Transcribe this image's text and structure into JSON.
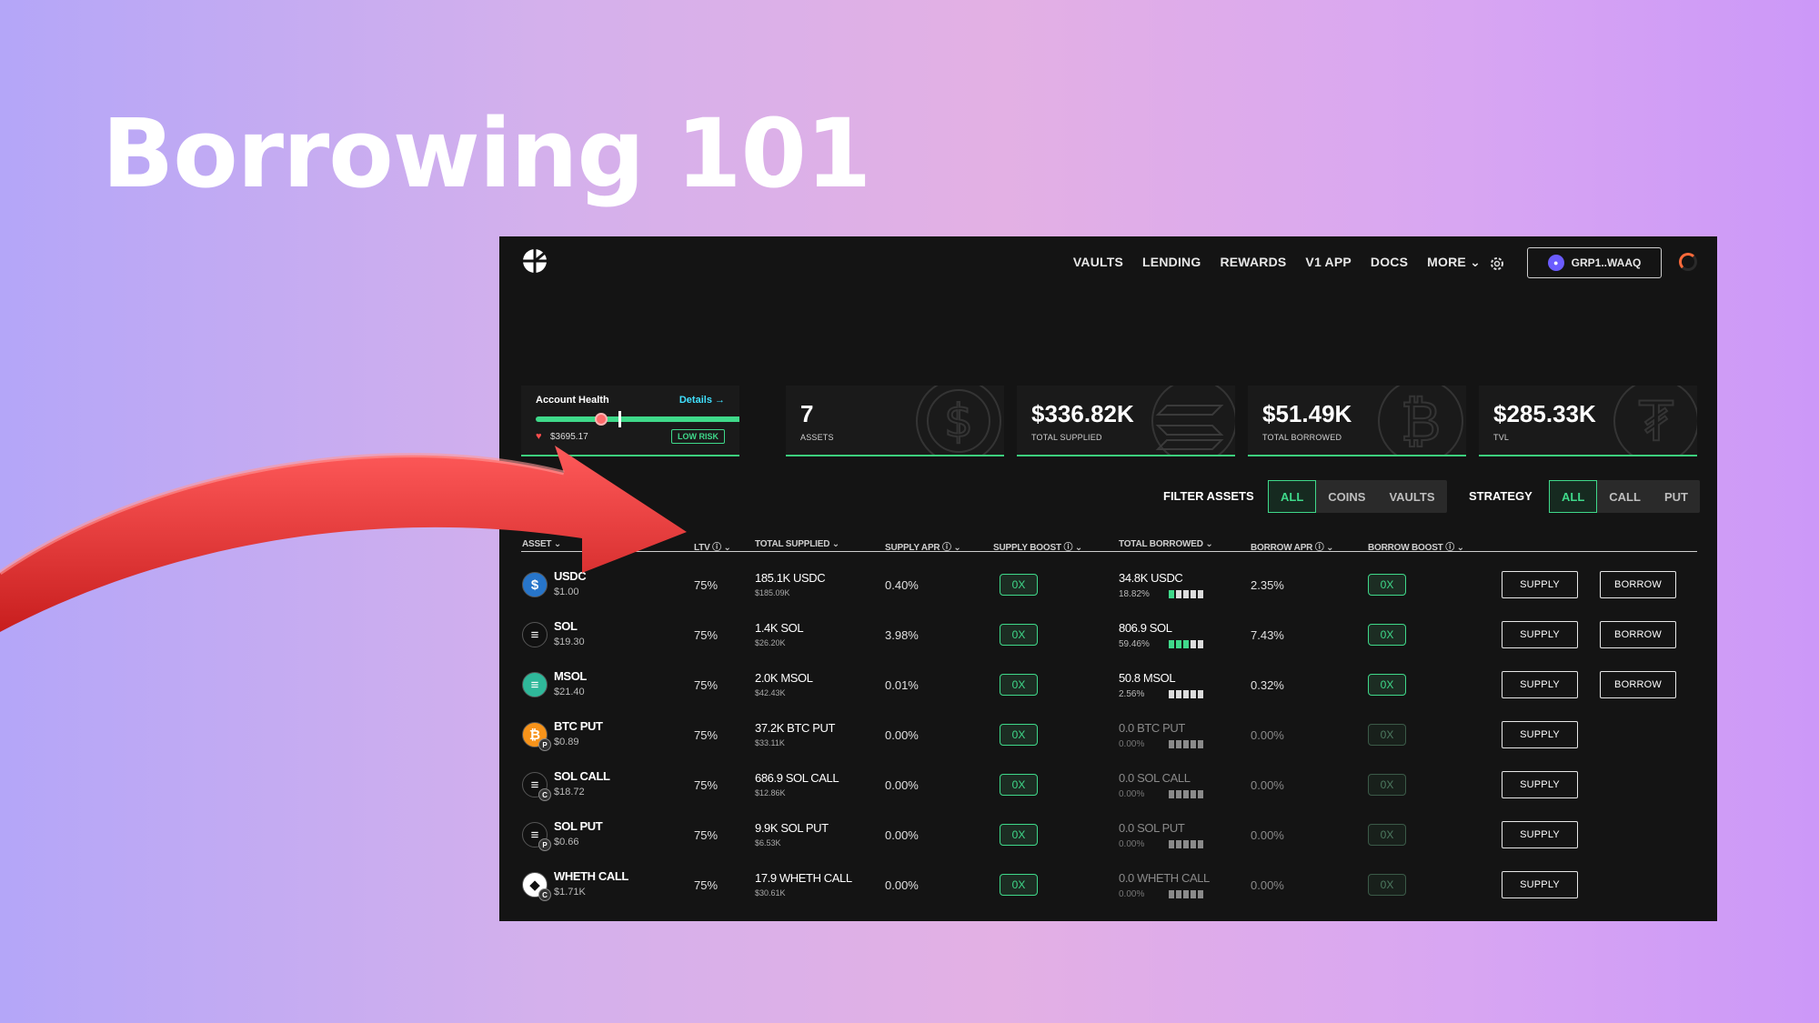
{
  "headline": "Borrowing 101",
  "nav": {
    "items": [
      "VAULTS",
      "LENDING",
      "REWARDS",
      "V1 APP",
      "DOCS",
      "MORE"
    ],
    "wallet_label": "GRP1..WAAQ"
  },
  "stats": {
    "health": {
      "title": "Account Health",
      "details": "Details →",
      "amount": "$3695.17",
      "risk": "LOW RISK",
      "level": 0.3
    },
    "assets": {
      "value": "7",
      "label": "ASSETS"
    },
    "supplied": {
      "value": "$336.82K",
      "label": "TOTAL SUPPLIED"
    },
    "borrowed": {
      "value": "$51.49K",
      "label": "TOTAL BORROWED"
    },
    "tvl": {
      "value": "$285.33K",
      "label": "TVL"
    }
  },
  "filters": {
    "label": "FILTER ASSETS",
    "options": [
      "ALL",
      "COINS",
      "VAULTS"
    ],
    "strategy_label": "STRATEGY",
    "strategy_options": [
      "ALL",
      "CALL",
      "PUT"
    ]
  },
  "table": {
    "headers": [
      "ASSET",
      "LTV",
      "TOTAL SUPPLIED",
      "SUPPLY APR",
      "SUPPLY BOOST",
      "TOTAL BORROWED",
      "BORROW APR",
      "BORROW BOOST"
    ],
    "supply_label": "SUPPLY",
    "borrow_label": "BORROW",
    "rows": [
      {
        "name": "USDC",
        "price": "$1.00",
        "ltv": "75%",
        "supplied": "185.1K USDC",
        "supplied_usd": "$185.09K",
        "supply_apr": "0.40%",
        "supply_boost": "0X",
        "borrowed_amt": "34.8K",
        "borrowed_sym": "USDC",
        "util": "18.82%",
        "util_bars": 1,
        "borrow_apr": "2.35%",
        "borrow_boost": "0X",
        "borrowable": true,
        "icon_color": "#2775ca",
        "icon": "$",
        "sub": ""
      },
      {
        "name": "SOL",
        "price": "$19.30",
        "ltv": "75%",
        "supplied": "1.4K SOL",
        "supplied_usd": "$26.20K",
        "supply_apr": "3.98%",
        "supply_boost": "0X",
        "borrowed_amt": "806.9",
        "borrowed_sym": "SOL",
        "util": "59.46%",
        "util_bars": 3,
        "borrow_apr": "7.43%",
        "borrow_boost": "0X",
        "borrowable": true,
        "icon_color": "#111111",
        "icon": "≡",
        "sub": ""
      },
      {
        "name": "MSOL",
        "price": "$21.40",
        "ltv": "75%",
        "supplied": "2.0K MSOL",
        "supplied_usd": "$42.43K",
        "supply_apr": "0.01%",
        "supply_boost": "0X",
        "borrowed_amt": "50.8",
        "borrowed_sym": "MSOL",
        "util": "2.56%",
        "util_bars": 0,
        "borrow_apr": "0.32%",
        "borrow_boost": "0X",
        "borrowable": true,
        "icon_color": "#2fb89a",
        "icon": "≡",
        "sub": ""
      },
      {
        "name": "BTC PUT",
        "price": "$0.89",
        "ltv": "75%",
        "supplied": "37.2K BTC PUT",
        "supplied_usd": "$33.11K",
        "supply_apr": "0.00%",
        "supply_boost": "0X",
        "borrowed_amt": "0.0",
        "borrowed_sym": "BTC PUT",
        "util": "0.00%",
        "util_bars": 0,
        "borrow_apr": "0.00%",
        "borrow_boost": "0X",
        "borrowable": false,
        "icon_color": "#f7931a",
        "icon": "₿",
        "sub": "P"
      },
      {
        "name": "SOL CALL",
        "price": "$18.72",
        "ltv": "75%",
        "supplied": "686.9 SOL CALL",
        "supplied_usd": "$12.86K",
        "supply_apr": "0.00%",
        "supply_boost": "0X",
        "borrowed_amt": "0.0",
        "borrowed_sym": "SOL CALL",
        "util": "0.00%",
        "util_bars": 0,
        "borrow_apr": "0.00%",
        "borrow_boost": "0X",
        "borrowable": false,
        "icon_color": "#111111",
        "icon": "≡",
        "sub": "C"
      },
      {
        "name": "SOL PUT",
        "price": "$0.66",
        "ltv": "75%",
        "supplied": "9.9K SOL PUT",
        "supplied_usd": "$6.53K",
        "supply_apr": "0.00%",
        "supply_boost": "0X",
        "borrowed_amt": "0.0",
        "borrowed_sym": "SOL PUT",
        "util": "0.00%",
        "util_bars": 0,
        "borrow_apr": "0.00%",
        "borrow_boost": "0X",
        "borrowable": false,
        "icon_color": "#111111",
        "icon": "≡",
        "sub": "P"
      },
      {
        "name": "WHETH CALL",
        "price": "$1.71K",
        "ltv": "75%",
        "supplied": "17.9 WHETH CALL",
        "supplied_usd": "$30.61K",
        "supply_apr": "0.00%",
        "supply_boost": "0X",
        "borrowed_amt": "0.0",
        "borrowed_sym": "WHETH CALL",
        "util": "0.00%",
        "util_bars": 0,
        "borrow_apr": "0.00%",
        "borrow_boost": "0X",
        "borrowable": false,
        "icon_color": "#ffffff",
        "icon": "◆",
        "sub": "C"
      }
    ]
  }
}
